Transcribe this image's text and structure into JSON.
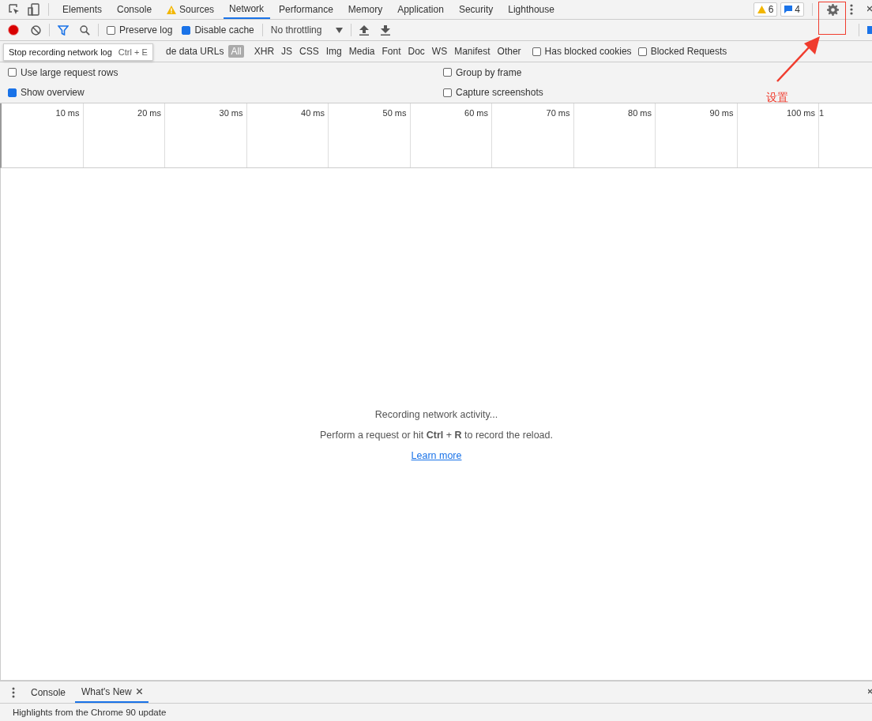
{
  "panel_tabs": [
    {
      "label": "Elements",
      "selected": false,
      "warning": false
    },
    {
      "label": "Console",
      "selected": false,
      "warning": false
    },
    {
      "label": "Sources",
      "selected": false,
      "warning": true
    },
    {
      "label": "Network",
      "selected": true,
      "warning": false
    },
    {
      "label": "Performance",
      "selected": false,
      "warning": false
    },
    {
      "label": "Memory",
      "selected": false,
      "warning": false
    },
    {
      "label": "Application",
      "selected": false,
      "warning": false
    },
    {
      "label": "Security",
      "selected": false,
      "warning": false
    },
    {
      "label": "Lighthouse",
      "selected": false,
      "warning": false
    }
  ],
  "counters": [
    {
      "kind": "warning",
      "count": "6"
    },
    {
      "kind": "message",
      "count": "4"
    }
  ],
  "toolbar": {
    "preserve_log": {
      "label": "Preserve log",
      "checked": false
    },
    "disable_cache": {
      "label": "Disable cache",
      "checked": true
    },
    "throttling": "No throttling"
  },
  "tooltip": {
    "text": "Stop recording network log",
    "shortcut": "Ctrl + E"
  },
  "filter_row": {
    "hide_data_urls": "de data URLs",
    "types": [
      {
        "label": "All",
        "selected": true
      },
      {
        "label": "XHR",
        "selected": false
      },
      {
        "label": "JS",
        "selected": false
      },
      {
        "label": "CSS",
        "selected": false
      },
      {
        "label": "Img",
        "selected": false
      },
      {
        "label": "Media",
        "selected": false
      },
      {
        "label": "Font",
        "selected": false
      },
      {
        "label": "Doc",
        "selected": false
      },
      {
        "label": "WS",
        "selected": false
      },
      {
        "label": "Manifest",
        "selected": false
      },
      {
        "label": "Other",
        "selected": false
      }
    ],
    "checks": [
      {
        "label": "Has blocked cookies",
        "checked": false
      },
      {
        "label": "Blocked Requests",
        "checked": false
      }
    ]
  },
  "settings": {
    "left": [
      {
        "label": "Use large request rows",
        "checked": false
      },
      {
        "label": "Show overview",
        "checked": true
      }
    ],
    "right": [
      {
        "label": "Group by frame",
        "checked": false
      },
      {
        "label": "Capture screenshots",
        "checked": false
      }
    ]
  },
  "overview_ticks": [
    "10 ms",
    "20 ms",
    "30 ms",
    "40 ms",
    "50 ms",
    "60 ms",
    "70 ms",
    "80 ms",
    "90 ms",
    "100 ms",
    "1"
  ],
  "empty_state": {
    "title": "Recording network activity...",
    "hint": "Perform a request or hit **Ctrl** + **R** to record the reload.",
    "link": "Learn more"
  },
  "drawer": {
    "tabs": [
      {
        "label": "Console",
        "selected": false,
        "closable": false
      },
      {
        "label": "What's New",
        "selected": true,
        "closable": true
      }
    ],
    "content": "Highlights from the Chrome 90 update"
  },
  "annotation": {
    "label": "设置"
  }
}
